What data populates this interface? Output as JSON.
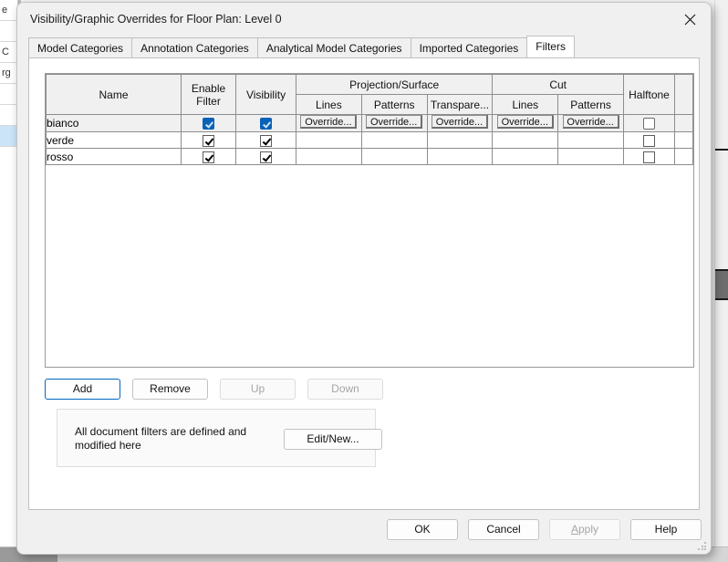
{
  "window": {
    "title": "Visibility/Graphic Overrides for Floor Plan: Level 0",
    "close_icon": "close-icon"
  },
  "tabs": [
    {
      "label": "Model Categories",
      "active": false
    },
    {
      "label": "Annotation Categories",
      "active": false
    },
    {
      "label": "Analytical Model Categories",
      "active": false
    },
    {
      "label": "Imported Categories",
      "active": false
    },
    {
      "label": "Filters",
      "active": true
    }
  ],
  "table": {
    "headers": {
      "name": "Name",
      "enable_filter": "Enable\nFilter",
      "enable_filter_line1": "Enable",
      "enable_filter_line2": "Filter",
      "visibility": "Visibility",
      "projection_surface": "Projection/Surface",
      "cut": "Cut",
      "halftone": "Halftone",
      "ps_lines": "Lines",
      "ps_patterns": "Patterns",
      "ps_transparency": "Transpare...",
      "cut_lines": "Lines",
      "cut_patterns": "Patterns"
    },
    "override_label": "Override...",
    "rows": [
      {
        "name": "bianco",
        "selected": true,
        "enable_filter": true,
        "visibility": true,
        "halftone": false,
        "has_overrides": true
      },
      {
        "name": "verde",
        "selected": false,
        "enable_filter": true,
        "visibility": true,
        "halftone": false,
        "has_overrides": false
      },
      {
        "name": "rosso",
        "selected": false,
        "enable_filter": true,
        "visibility": true,
        "halftone": false,
        "has_overrides": false
      }
    ]
  },
  "actions": {
    "add": "Add",
    "remove": "Remove",
    "up": "Up",
    "down": "Down"
  },
  "info": {
    "text": "All document filters are defined and modified here",
    "edit_new": "Edit/New..."
  },
  "footer": {
    "ok": "OK",
    "cancel": "Cancel",
    "apply": "Apply",
    "apply_mnemonic": "A",
    "apply_rest": "pply",
    "help": "Help"
  },
  "colors": {
    "accent": "#0a62b8",
    "focus_border": "#0067c0",
    "dialog_bg": "#f0f0f0",
    "selected_row": "#f0f0f0",
    "disabled_text": "#a6a6a6"
  }
}
